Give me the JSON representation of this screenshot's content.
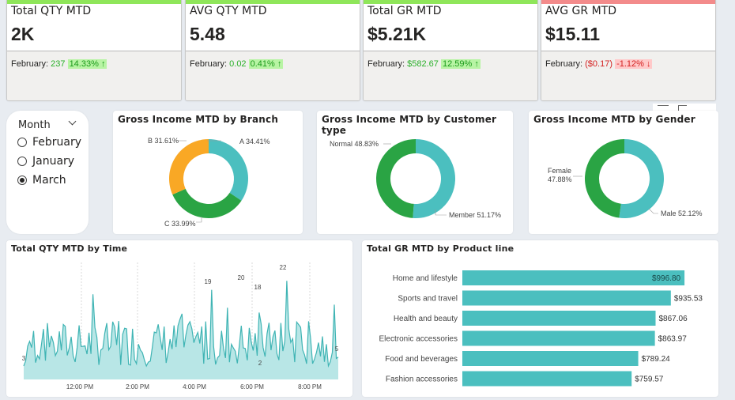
{
  "kpis": [
    {
      "title": "Total QTY MTD",
      "value": "2K",
      "month": "February:",
      "delta": "237",
      "pct": "14.33%",
      "dir": "up",
      "color": "#8fe65a"
    },
    {
      "title": "AVG QTY MTD",
      "value": "5.48",
      "month": "February:",
      "delta": "0.02",
      "pct": "0.41%",
      "dir": "up",
      "color": "#8fe65a"
    },
    {
      "title": "Total GR MTD",
      "value": "$5.21K",
      "month": "February:",
      "delta": "$582.67",
      "pct": "12.59%",
      "dir": "up",
      "color": "#8fe65a"
    },
    {
      "title": "AVG GR MTD",
      "value": "$15.11",
      "month": "February:",
      "delta": "($0.17)",
      "pct": "-1.12%",
      "dir": "down",
      "color": "#f38b8b"
    }
  ],
  "slicer": {
    "title": "Month",
    "options": [
      {
        "label": "February",
        "selected": false
      },
      {
        "label": "January",
        "selected": false
      },
      {
        "label": "March",
        "selected": true
      }
    ]
  },
  "donuts": {
    "branch": {
      "title": "Gross Income MTD by Branch",
      "slices": [
        {
          "label": "A 34.41%",
          "value": 34.41,
          "color": "#4bbfbf"
        },
        {
          "label": "C 33.99%",
          "value": 33.99,
          "color": "#2aa444"
        },
        {
          "label": "B 31.61%",
          "value": 31.61,
          "color": "#f9a825"
        }
      ]
    },
    "customer": {
      "title": "Gross Income MTD by Customer type",
      "slices": [
        {
          "label": "Member 51.17%",
          "value": 51.17,
          "color": "#4bbfbf"
        },
        {
          "label": "Normal 48.83%",
          "value": 48.83,
          "color": "#2aa444"
        }
      ]
    },
    "gender": {
      "title": "Gross Income MTD by Gender",
      "slices": [
        {
          "label": "Male 52.12%",
          "value": 52.12,
          "color": "#4bbfbf"
        },
        {
          "label": "Female 47.88%",
          "value": 47.88,
          "color": "#2aa444"
        }
      ]
    }
  },
  "line_chart": {
    "title": "Total QTY MTD by Time",
    "x_labels": [
      "12:00 PM",
      "2:00 PM",
      "4:00 PM",
      "6:00 PM",
      "8:00 PM"
    ],
    "annotations": [
      "3",
      "19",
      "20",
      "18",
      "22",
      "2",
      "5"
    ]
  },
  "bar_chart": {
    "title": "Total GR MTD by Product line",
    "categories": [
      "Home and lifestyle",
      "Sports and travel",
      "Health and beauty",
      "Electronic accessories",
      "Food and beverages",
      "Fashion accessories"
    ],
    "values": [
      996.8,
      935.53,
      867.06,
      863.97,
      789.24,
      759.57
    ],
    "labels": [
      "$996.80",
      "$935.53",
      "$867.06",
      "$863.97",
      "$789.24",
      "$759.57"
    ],
    "color": "#4bbfbf"
  },
  "chart_data": [
    {
      "type": "pie",
      "title": "Gross Income MTD by Branch",
      "categories": [
        "A",
        "C",
        "B"
      ],
      "values": [
        34.41,
        33.99,
        31.61
      ]
    },
    {
      "type": "pie",
      "title": "Gross Income MTD by Customer type",
      "categories": [
        "Member",
        "Normal"
      ],
      "values": [
        51.17,
        48.83
      ]
    },
    {
      "type": "pie",
      "title": "Gross Income MTD by Gender",
      "categories": [
        "Male",
        "Female"
      ],
      "values": [
        52.12,
        47.88
      ]
    },
    {
      "type": "bar",
      "title": "Total GR MTD by Product line",
      "categories": [
        "Home and lifestyle",
        "Sports and travel",
        "Health and beauty",
        "Electronic accessories",
        "Food and beverages",
        "Fashion accessories"
      ],
      "values": [
        996.8,
        935.53,
        867.06,
        863.97,
        789.24,
        759.57
      ]
    },
    {
      "type": "area",
      "title": "Total QTY MTD by Time",
      "x": [
        "12:00 PM",
        "2:00 PM",
        "4:00 PM",
        "6:00 PM",
        "8:00 PM"
      ]
    }
  ]
}
